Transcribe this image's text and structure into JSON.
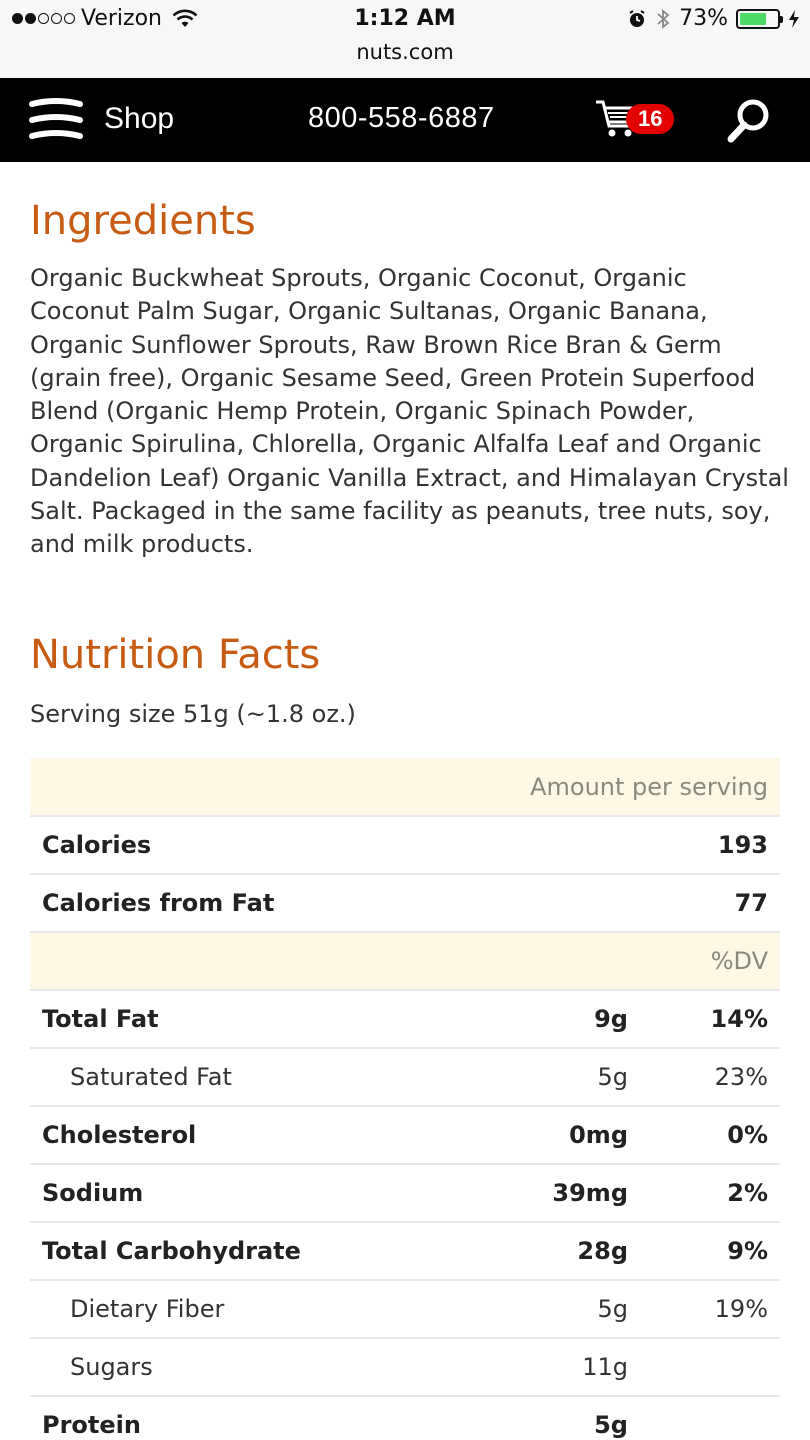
{
  "status_bar": {
    "carrier": "Verizon",
    "signal_bars_filled": 2,
    "signal_bars_total": 5,
    "time": "1:12 AM",
    "url": "nuts.com",
    "battery_percent": "73%",
    "battery_level": 0.73
  },
  "navbar": {
    "shop_label": "Shop",
    "phone": "800-558-6887",
    "cart_count": "16"
  },
  "ingredients": {
    "title": "Ingredients",
    "text": "Organic Buckwheat Sprouts, Organic Coconut, Organic Coconut Palm Sugar, Organic Sultanas, Organic Banana, Organic Sunflower Sprouts, Raw Brown Rice Bran & Germ (grain free), Organic Sesame Seed, Green Protein Superfood Blend (Organic Hemp Protein, Organic Spinach Powder, Organic Spirulina, Chlorella, Organic Alfalfa Leaf and Organic Dandelion Leaf) Organic Vanilla Extract, and Himalayan Crystal Salt. Packaged in the same facility as peanuts, tree nuts, soy, and milk products."
  },
  "nutrition": {
    "title": "Nutrition Facts",
    "serving_size": "Serving size 51g (~1.8 oz.)",
    "amount_header": "Amount per serving",
    "calories_label": "Calories",
    "calories_value": "193",
    "calories_fat_label": "Calories from Fat",
    "calories_fat_value": "77",
    "dv_header": "%DV",
    "rows": [
      {
        "name": "Total Fat",
        "amount": "9g",
        "dv": "14%",
        "bold": true
      },
      {
        "name": "Saturated Fat",
        "amount": "5g",
        "dv": "23%",
        "bold": false
      },
      {
        "name": "Cholesterol",
        "amount": "0mg",
        "dv": "0%",
        "bold": true
      },
      {
        "name": "Sodium",
        "amount": "39mg",
        "dv": "2%",
        "bold": true
      },
      {
        "name": "Total Carbohydrate",
        "amount": "28g",
        "dv": "9%",
        "bold": true
      },
      {
        "name": "Dietary Fiber",
        "amount": "5g",
        "dv": "19%",
        "bold": false
      },
      {
        "name": "Sugars",
        "amount": "11g",
        "dv": "",
        "bold": false
      },
      {
        "name": "Protein",
        "amount": "5g",
        "dv": "",
        "bold": true
      }
    ]
  },
  "colors": {
    "accent": "#c75b12",
    "nav_bg": "#000000",
    "badge": "#e30000",
    "table_header_bg": "#fdf8e6"
  }
}
